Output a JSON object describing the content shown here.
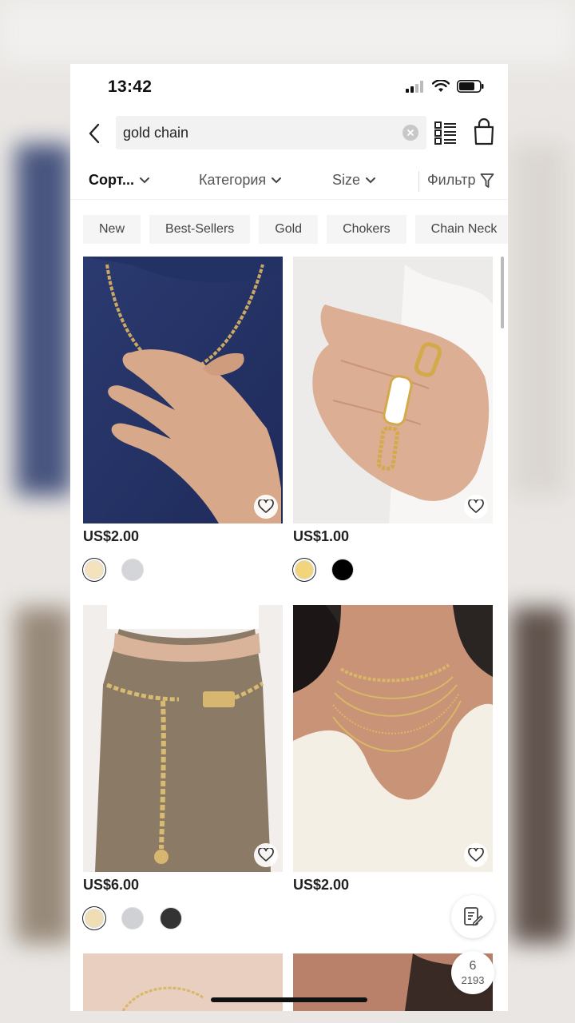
{
  "status": {
    "time": "13:42"
  },
  "search": {
    "query": "gold chain"
  },
  "filters": {
    "sort": "Сорт...",
    "category": "Категория",
    "size": "Size",
    "filter": "Фильтр"
  },
  "tags": [
    "New",
    "Best-Sellers",
    "Gold",
    "Chokers",
    "Chain Neck"
  ],
  "products": [
    {
      "price": "US$2.00",
      "swatches": [
        "#f3e2bb",
        "#d4d5d8"
      ]
    },
    {
      "price": "US$1.00",
      "swatches": [
        "#f2d47a",
        "#000000"
      ]
    },
    {
      "price": "US$6.00",
      "swatches": [
        "#f1ddb3",
        "#d0d1d4",
        "#333333"
      ]
    },
    {
      "price": "US$2.00",
      "swatches": []
    }
  ],
  "pager": {
    "current": "6",
    "total": "2193"
  },
  "colors": {
    "accent": "#111111",
    "price": "#222222",
    "tag_bg": "#f5f5f5"
  },
  "icons": [
    "back-icon",
    "clear-icon",
    "grid-view-icon",
    "bag-icon",
    "chevron-down-icon",
    "filter-icon",
    "heart-icon",
    "edit-icon",
    "signal-icon",
    "wifi-icon",
    "battery-icon"
  ]
}
